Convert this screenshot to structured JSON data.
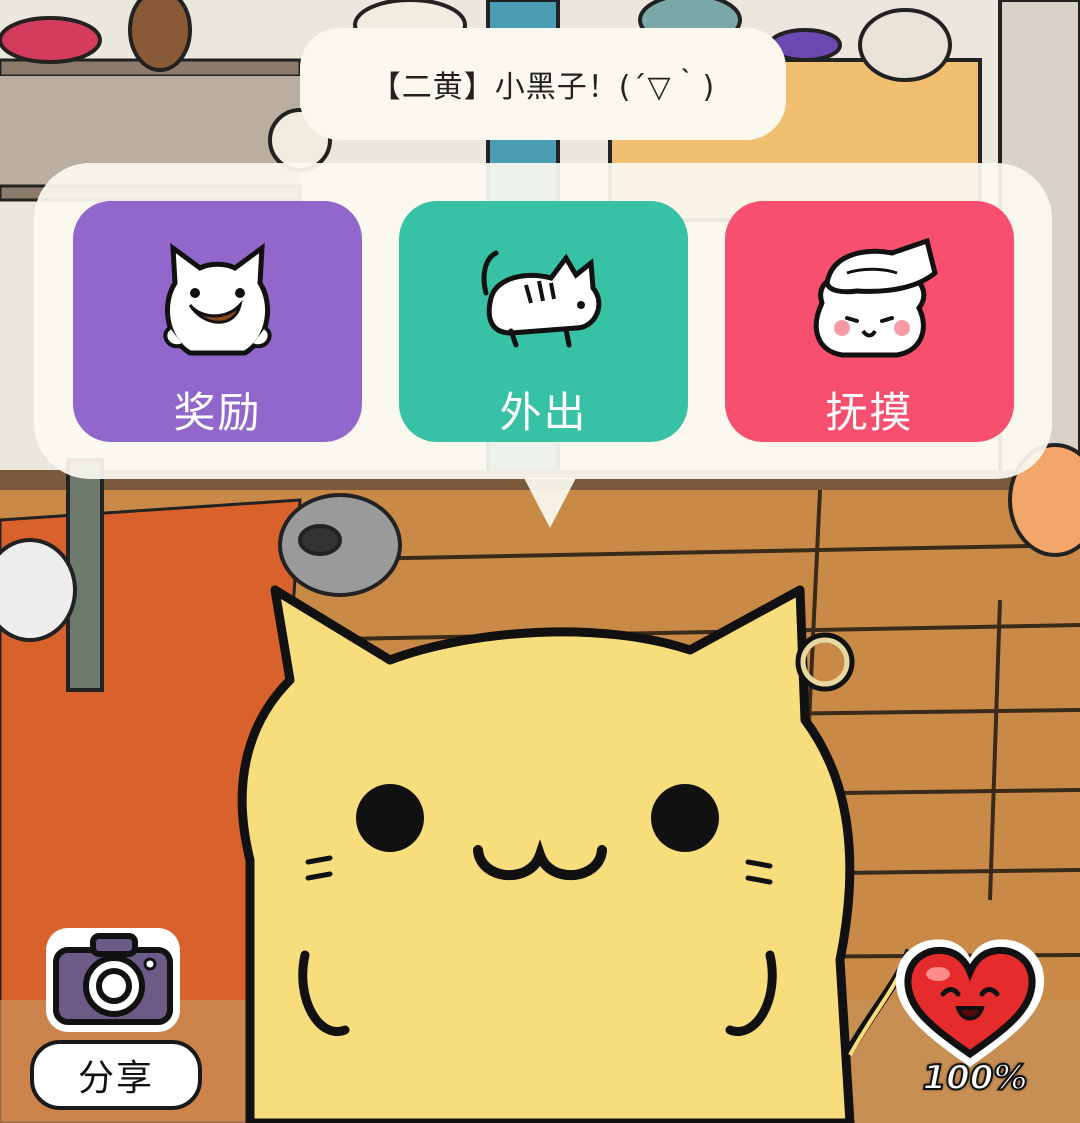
{
  "speech": {
    "text": "【二黄】小黑子！(´▽｀)"
  },
  "actions": [
    {
      "label": "奖励",
      "icon": "cat-eating-icon",
      "color": "#9267cc"
    },
    {
      "label": "外出",
      "icon": "cat-walking-icon",
      "color": "#37c2a6"
    },
    {
      "label": "抚摸",
      "icon": "cat-petted-icon",
      "color": "#f7506f"
    }
  ],
  "share": {
    "label": "分享",
    "icon": "camera-icon"
  },
  "affection": {
    "value": "100%",
    "icon": "heart-icon",
    "level": 1.0
  }
}
